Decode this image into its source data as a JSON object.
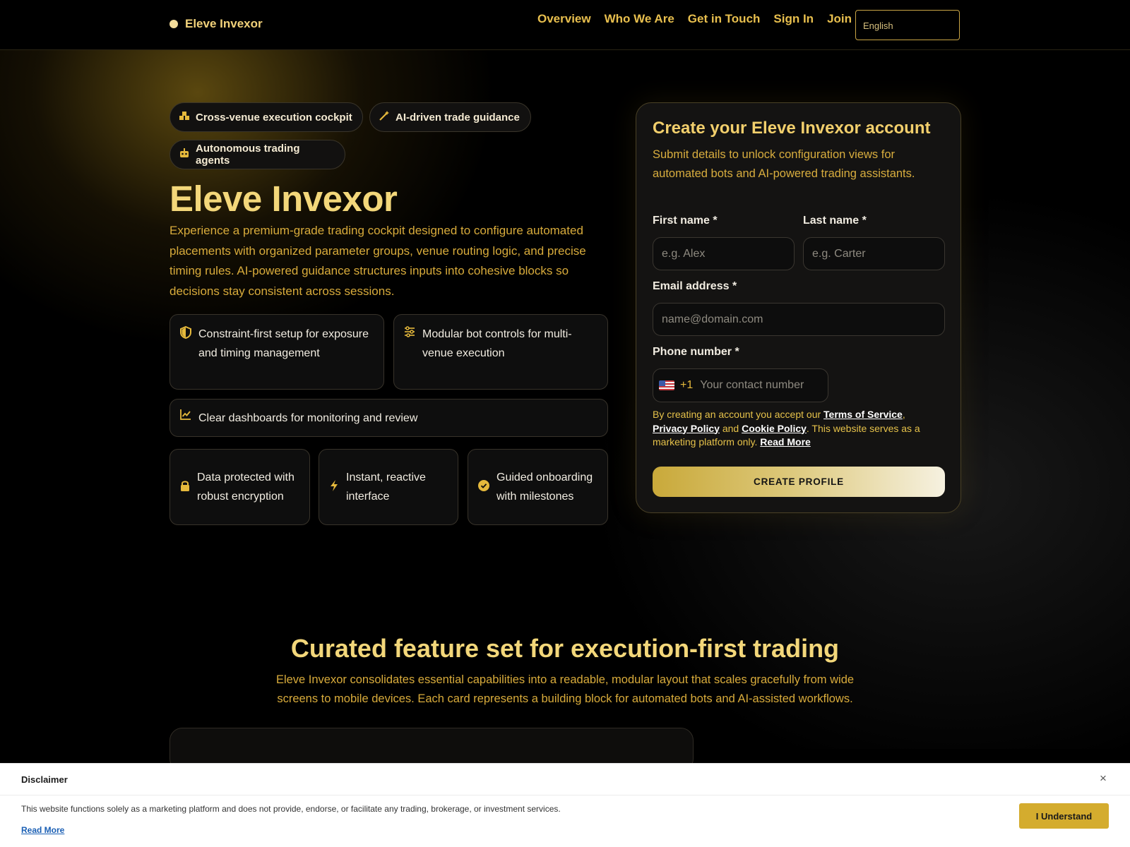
{
  "header": {
    "brand": "Eleve Invexor",
    "nav": [
      "Overview",
      "Who We Are",
      "Get in Touch",
      "Sign In",
      "Join"
    ],
    "language": "English"
  },
  "hero": {
    "chips": [
      {
        "label": "Cross-venue execution cockpit",
        "icon": "cubes-icon"
      },
      {
        "label": "AI-driven trade guidance",
        "icon": "magic-wand-icon"
      },
      {
        "label": "Autonomous trading agents",
        "icon": "robot-icon"
      }
    ],
    "title": "Eleve Invexor",
    "description": "Experience a premium-grade trading cockpit designed to configure automated placements with organized parameter groups, venue routing logic, and precise timing rules. AI-powered guidance structures inputs into cohesive blocks so decisions stay consistent across sessions.",
    "features": [
      {
        "text": "Constraint-first setup for exposure and timing management",
        "icon": "shield-icon"
      },
      {
        "text": "Modular bot controls for multi-venue execution",
        "icon": "sliders-icon"
      },
      {
        "text": "Clear dashboards for monitoring and review",
        "icon": "chart-line-icon"
      }
    ],
    "badges": [
      {
        "text": "Data protected with robust encryption",
        "icon": "lock-icon"
      },
      {
        "text": "Instant, reactive interface",
        "icon": "lightning-icon"
      },
      {
        "text": "Guided onboarding with milestones",
        "icon": "check-circle-icon"
      }
    ]
  },
  "form": {
    "title": "Create your Eleve Invexor account",
    "subtitle": "Submit details to unlock configuration views for automated bots and AI-powered trading assistants.",
    "first_name_label": "First name *",
    "first_name_placeholder": "e.g. Alex",
    "last_name_label": "Last name *",
    "last_name_placeholder": "e.g. Carter",
    "email_label": "Email address *",
    "email_placeholder": "name@domain.com",
    "phone_label": "Phone number *",
    "phone_dial_code": "+1",
    "phone_placeholder": "Your contact number",
    "terms_prefix": "By creating an account you accept our ",
    "terms_link": "Terms of Service",
    "terms_comma": ",",
    "privacy_link": "Privacy Policy",
    "terms_and": " and ",
    "cookie_link": "Cookie Policy",
    "terms_suffix": ". This website serves as a marketing platform only. ",
    "read_more": "Read More",
    "submit": "CREATE PROFILE"
  },
  "features_section": {
    "title": "Curated feature set for execution-first trading",
    "description": "Eleve Invexor consolidates essential capabilities into a readable, modular layout that scales gracefully from wide screens to mobile devices. Each card represents a building block for automated bots and AI-assisted workflows."
  },
  "disclaimer": {
    "title": "Disclaimer",
    "close": "×",
    "text": "This website functions solely as a marketing platform and does not provide, endorse, or facilitate any trading, brokerage, or investment services.",
    "read_more": "Read More",
    "button": "I Understand"
  },
  "colors": {
    "accent_gold": "#e8bf4e",
    "title_gold": "#f3d77a",
    "background": "#000000",
    "disclaimer_button": "#d4ac2e"
  }
}
